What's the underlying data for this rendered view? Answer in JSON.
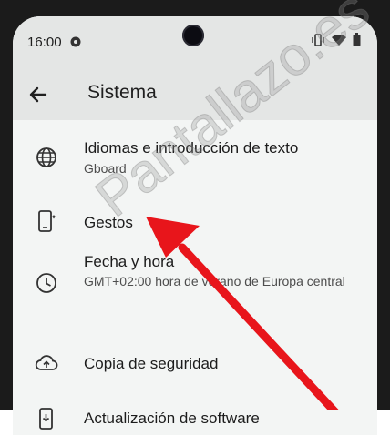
{
  "status_bar": {
    "time": "16:00",
    "icons": [
      "message-icon",
      "vibrate-icon",
      "wifi-icon",
      "battery-icon"
    ]
  },
  "app_bar": {
    "title": "Sistema",
    "back_icon": "arrow-back-icon"
  },
  "items": [
    {
      "icon": "globe-icon",
      "label": "Idiomas e introducción de texto",
      "sub": "Gboard"
    },
    {
      "icon": "gesture-phone-icon",
      "label": "Gestos",
      "sub": ""
    },
    {
      "icon": "clock-icon",
      "label": "Fecha y hora",
      "sub": "GMT+02:00 hora de verano de Europa central"
    },
    {
      "icon": "cloud-upload-icon",
      "label": "Copia de seguridad",
      "sub": ""
    },
    {
      "icon": "system-update-icon",
      "label": "Actualización de software",
      "sub": ""
    }
  ],
  "watermark": "Pantallazo.es",
  "colors": {
    "arrow": "#e8151b",
    "app_bar": "#e4e6e5",
    "background": "#f3f5f4"
  }
}
